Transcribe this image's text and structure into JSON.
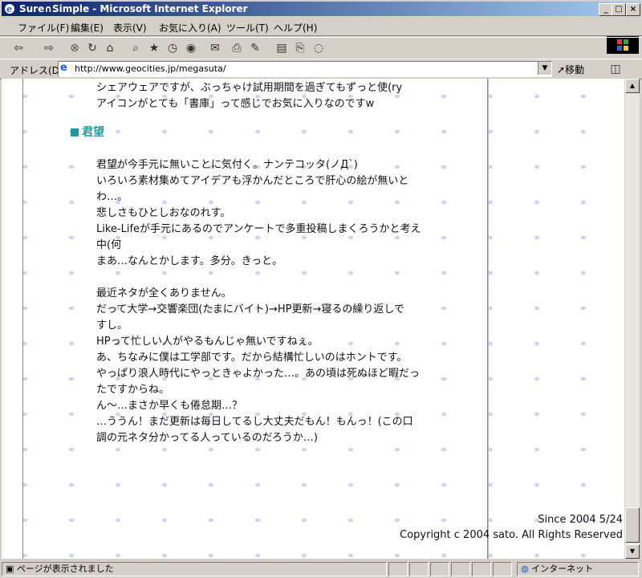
{
  "window": {
    "title": "Sure∩Simple - Microsoft Internet Explorer",
    "minimize": "_",
    "maximize": "□",
    "close": "×"
  },
  "menu": [
    "ファイル(F)",
    "編集(E)",
    "表示(V)",
    "お気に入り(A)",
    "ツール(T)",
    "ヘルプ(H)"
  ],
  "toolbar": {
    "icons": [
      "back-icon",
      "forward-icon",
      "stop-icon",
      "refresh-icon",
      "home-icon",
      "search-icon",
      "favorites-icon",
      "history-icon",
      "media-icon",
      "mail-icon",
      "print-icon",
      "edit-icon",
      "discuss-icon",
      "messenger-icon"
    ]
  },
  "address": {
    "label": "アドレス(D)",
    "url": "http://www.geocities.jp/megasuta/",
    "go_label": "移動"
  },
  "page": {
    "top_lines": [
      "シェアウェアですが、ぶっちゃけ試用期間を過ぎてもずっと使(ry",
      "アイコンがとても「書庫」って感じでお気に入りなのですw"
    ],
    "section_title": "君望",
    "body_lines": [
      "君望が今手元に無いことに気付く。ナンテコッタ(ノД`)",
      "いろいろ素材集めてアイデアも浮かんだところで肝心の絵が無いと",
      "わ…。",
      "悲しさもひとしおなのれす。",
      "Like-Lifeが手元にあるのでアンケートで多重投稿しまくろうかと考え",
      "中(何",
      "まあ…なんとかします。多分。きっと。",
      "",
      "最近ネタが全くありません。",
      "だって大学→交響楽団(たまにバイト)→HP更新→寝るの繰り返しで",
      "すし。",
      "HPって忙しい人がやるもんじゃ無いですねぇ。",
      "あ、ちなみに僕は工学部です。だから結構忙しいのはホントです。",
      "やっぱり浪人時代にやっときゃよかった…。あの頃は死ぬほど暇だっ",
      "たですからね。",
      "ん～…まさか早くも倦怠期…？",
      "…ううん！まだ更新は毎日してるし大丈夫だもん！もんっ！(この口",
      "調の元ネタ分かってる人っているのだろうか…)"
    ],
    "footer_since": "Since 2004 5/24",
    "footer_copyright": "Copyright c 2004 sato. All Rights Reserved"
  },
  "status": {
    "text": "ページが表示されました",
    "zone": "インターネット"
  }
}
